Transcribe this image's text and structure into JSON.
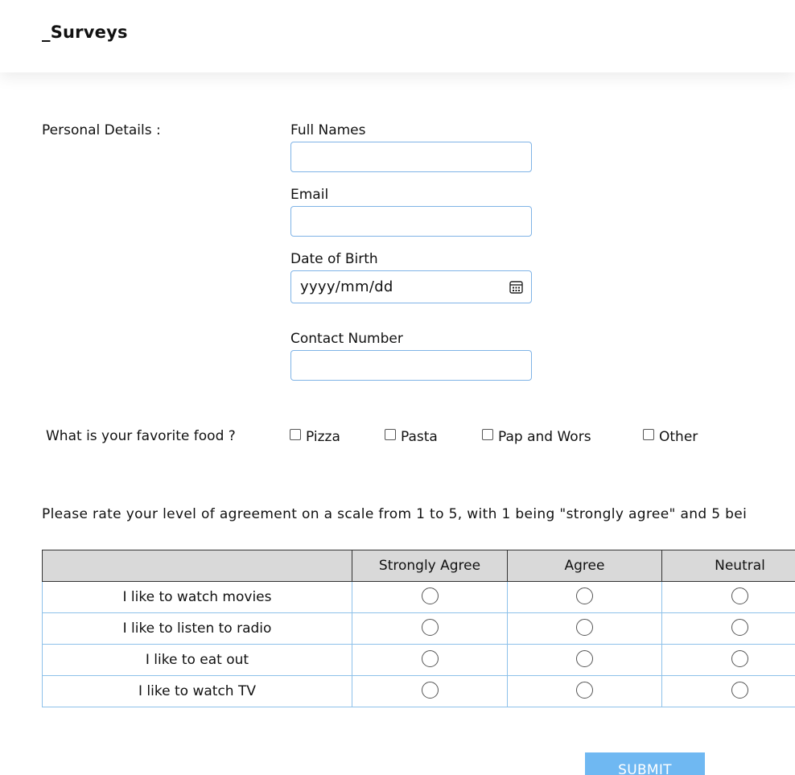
{
  "header": {
    "brand": "_Surveys"
  },
  "personal": {
    "section_label": "Personal Details :",
    "full_names": {
      "label": "Full Names",
      "value": "",
      "placeholder": ""
    },
    "email": {
      "label": "Email",
      "value": "",
      "placeholder": ""
    },
    "dob": {
      "label": "Date of Birth",
      "placeholder": "yyyy/mm/dd"
    },
    "contact": {
      "label": "Contact Number",
      "value": "",
      "placeholder": ""
    }
  },
  "food": {
    "question": "What is your favorite food ?",
    "options": [
      "Pizza",
      "Pasta",
      "Pap and Wors",
      "Other"
    ]
  },
  "rating": {
    "instruction": "Please rate your level of agreement on a scale from 1 to 5, with 1 being \"strongly agree\" and 5 bei",
    "columns": [
      "",
      "Strongly Agree",
      "Agree",
      "Neutral"
    ],
    "rows": [
      "I like to watch movies",
      "I like to listen to radio",
      "I like to eat out",
      "I like to watch TV"
    ]
  },
  "submit": {
    "label": "SUBMIT"
  },
  "colors": {
    "input_border": "#7fb3e6",
    "submit_bg": "#6fb8f2",
    "table_header_bg": "#d9d9d9",
    "table_border": "#8dc1ea"
  }
}
